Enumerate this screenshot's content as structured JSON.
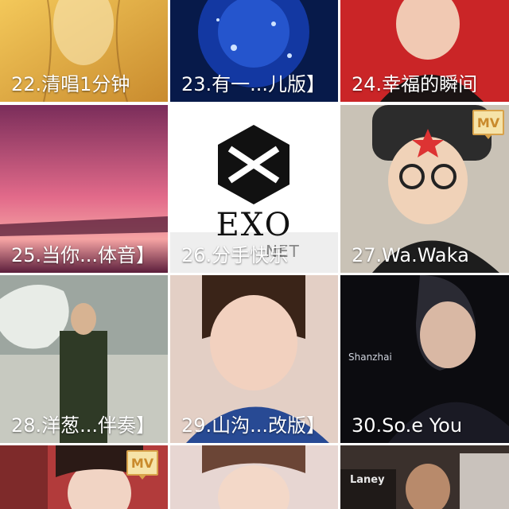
{
  "tiles": [
    {
      "id": "t22",
      "label": "22.清唱1分钟",
      "badge": ""
    },
    {
      "id": "t23",
      "label": "23.有一...儿版】",
      "badge": ""
    },
    {
      "id": "t24",
      "label": "24.幸福的瞬间",
      "badge": ""
    },
    {
      "id": "t25",
      "label": "25.当你...体音】",
      "badge": ""
    },
    {
      "id": "t26",
      "label": "26.分手快乐",
      "badge": "",
      "logo_text": "EXO",
      "logo_subtext": "NET"
    },
    {
      "id": "t27",
      "label": "27.Wa.Waka",
      "badge": "MV"
    },
    {
      "id": "t28",
      "label": "28.洋葱...伴奏】",
      "badge": ""
    },
    {
      "id": "t29",
      "label": "29.山沟...改版】",
      "badge": ""
    },
    {
      "id": "t30",
      "label": "30.So.e You",
      "badge": "",
      "photo_caption": "Shanzhai"
    },
    {
      "id": "t31",
      "label": "",
      "badge": "MV"
    },
    {
      "id": "t32",
      "label": "",
      "badge": ""
    },
    {
      "id": "t33",
      "label": "",
      "badge": "",
      "photo_caption": "Laney"
    }
  ],
  "colors": {
    "label": "#ffffff",
    "mv_bg": "#f6e3a8",
    "mv_border": "#d8a24a"
  }
}
